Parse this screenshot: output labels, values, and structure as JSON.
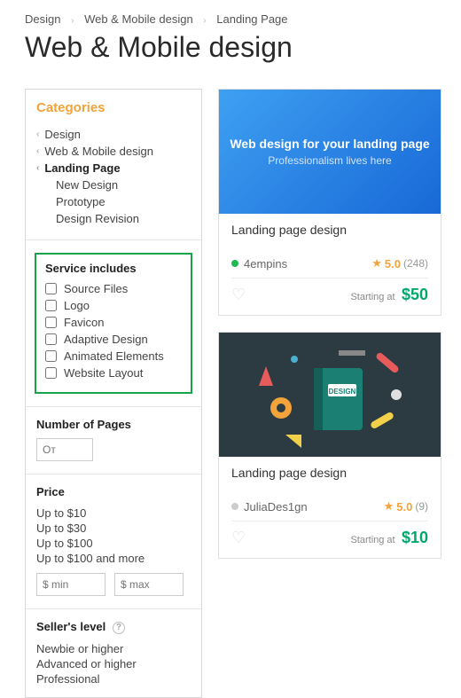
{
  "breadcrumb": [
    "Design",
    "Web & Mobile design",
    "Landing Page"
  ],
  "page_title": "Web & Mobile design",
  "sidebar": {
    "categories_label": "Categories",
    "tree": [
      {
        "label": "Design",
        "chevron": true
      },
      {
        "label": "Web & Mobile design",
        "chevron": true
      },
      {
        "label": "Landing Page",
        "chevron": true,
        "bold": true
      },
      {
        "label": "New Design",
        "sub": true
      },
      {
        "label": "Prototype",
        "sub": true
      },
      {
        "label": "Design Revision",
        "sub": true
      }
    ],
    "service_includes_label": "Service includes",
    "service_includes": [
      "Source Files",
      "Logo",
      "Favicon",
      "Adaptive Design",
      "Animated Elements",
      "Website Layout"
    ],
    "pages_label": "Number of Pages",
    "pages_from_placeholder": "От",
    "price_label": "Price",
    "price_options": [
      "Up to $10",
      "Up to $30",
      "Up to $100",
      "Up to $100 and more"
    ],
    "price_min_placeholder": "$ min",
    "price_max_placeholder": "$ max",
    "seller_level_label": "Seller's level",
    "seller_levels": [
      "Newbie or higher",
      "Advanced or higher",
      "Professional"
    ]
  },
  "cards": [
    {
      "banner_title": "Web design for your landing page",
      "banner_sub": "Professionalism lives here",
      "title": "Landing page design",
      "seller": "4empins",
      "online": true,
      "rating": "5.0",
      "rating_count": "(248)",
      "starting_label": "Starting at",
      "price": "$50"
    },
    {
      "banner_title": "DESIGN",
      "title": "Landing page design",
      "seller": "JuliaDes1gn",
      "online": false,
      "rating": "5.0",
      "rating_count": "(9)",
      "starting_label": "Starting at",
      "price": "$10"
    }
  ]
}
